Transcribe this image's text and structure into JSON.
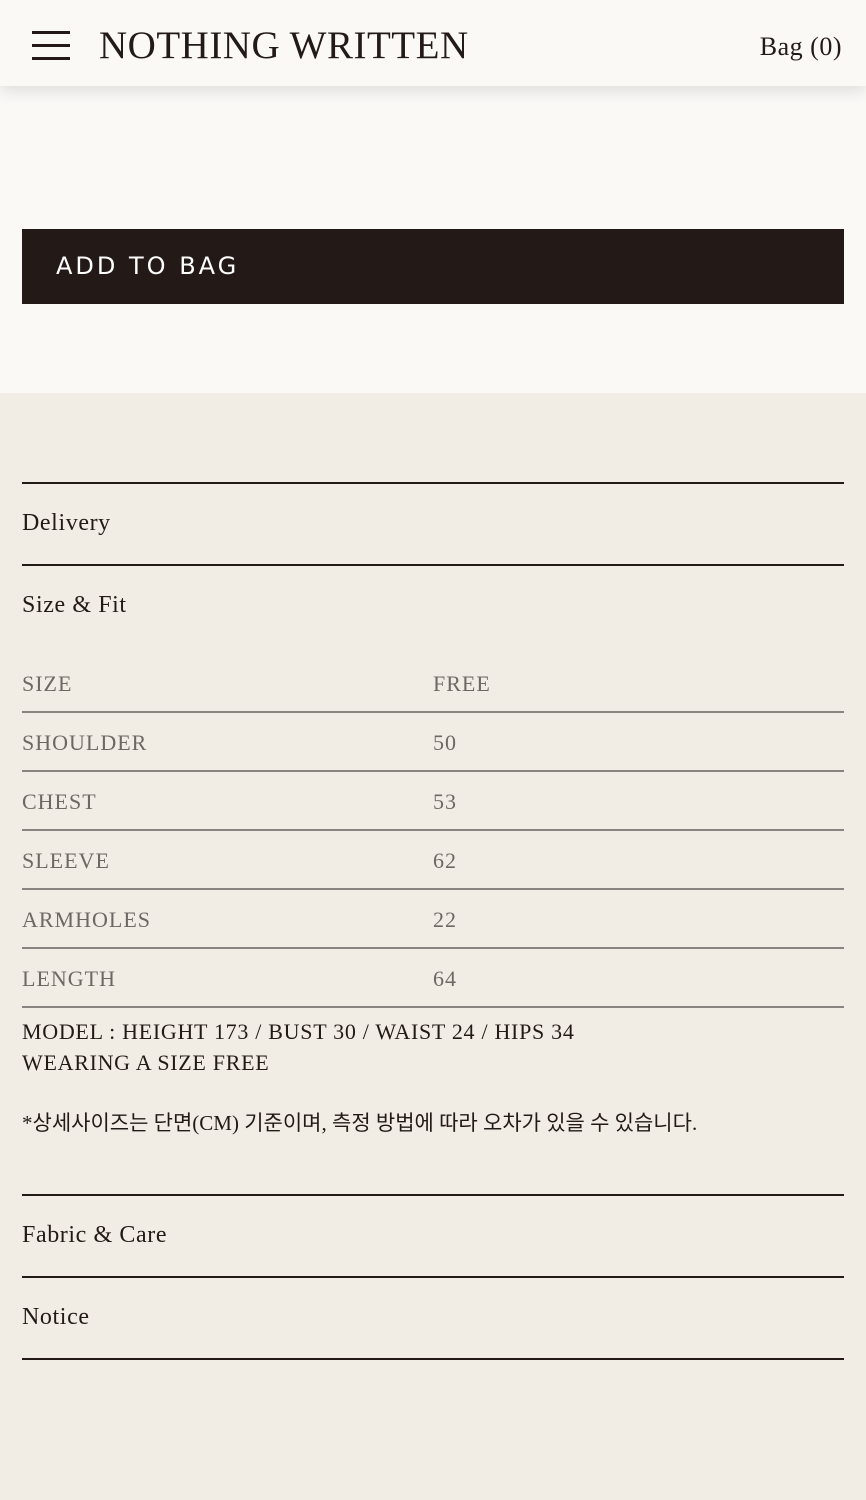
{
  "header": {
    "brand": "NOTHING WRITTEN",
    "bag_label": "Bag (0)"
  },
  "actions": {
    "add_to_bag": "ADD TO BAG"
  },
  "sections": {
    "delivery": "Delivery",
    "size_fit": "Size & Fit",
    "fabric_care": "Fabric & Care",
    "notice": "Notice"
  },
  "size_table": {
    "rows": [
      {
        "label": "SIZE",
        "value": "FREE"
      },
      {
        "label": "SHOULDER",
        "value": "50"
      },
      {
        "label": "CHEST",
        "value": "53"
      },
      {
        "label": "SLEEVE",
        "value": "62"
      },
      {
        "label": "ARMHOLES",
        "value": "22"
      },
      {
        "label": "LENGTH",
        "value": "64"
      }
    ]
  },
  "model_info": {
    "line1": "MODEL : HEIGHT 173 / BUST 30 / WAIST 24 / HIPS 34",
    "line2": "WEARING A SIZE FREE"
  },
  "size_note": "*상세사이즈는 단면(CM) 기준이며, 측정 방법에 따라 오차가 있을 수 있습니다.",
  "colors": {
    "primary": "#231a17",
    "background": "#f2ede4",
    "header_background": "#faf9f6"
  },
  "icons": {
    "menu": "hamburger-menu-icon"
  }
}
